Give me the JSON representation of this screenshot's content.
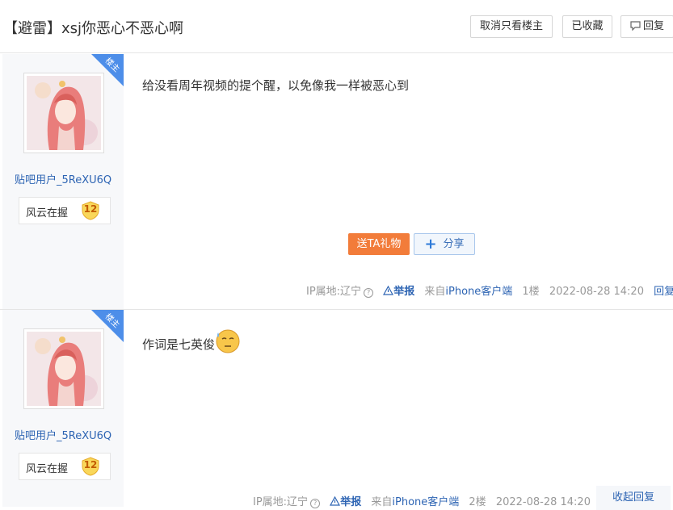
{
  "thread": {
    "title": "【避雷】xsj你恶心不恶心啊",
    "buttons": {
      "only_op": "取消只看楼主",
      "favorited": "已收藏",
      "reply": "回复"
    }
  },
  "posts": [
    {
      "badge": "楼主",
      "username": "贴吧用户_5ReXU6Q",
      "level_name": "风云在握",
      "level_num": "12",
      "content": "给没看周年视频的提个醒，以免像我一样被恶心到",
      "gift_label": "送TA礼物",
      "share_label": "分享",
      "ip": "IP属地:辽宁",
      "report": "举报",
      "from_prefix": "来自",
      "client": "iPhone客户端",
      "floor": "1楼",
      "time": "2022-08-28 14:20",
      "reply": "回复"
    },
    {
      "badge": "楼主",
      "username": "贴吧用户_5ReXU6Q",
      "level_name": "风云在握",
      "level_num": "12",
      "content": "作词是七英俊",
      "ip": "IP属地:辽宁",
      "report": "举报",
      "from_prefix": "来自",
      "client": "iPhone客户端",
      "floor": "2楼",
      "time": "2022-08-28 14:20",
      "collapse": "收起回复"
    }
  ]
}
